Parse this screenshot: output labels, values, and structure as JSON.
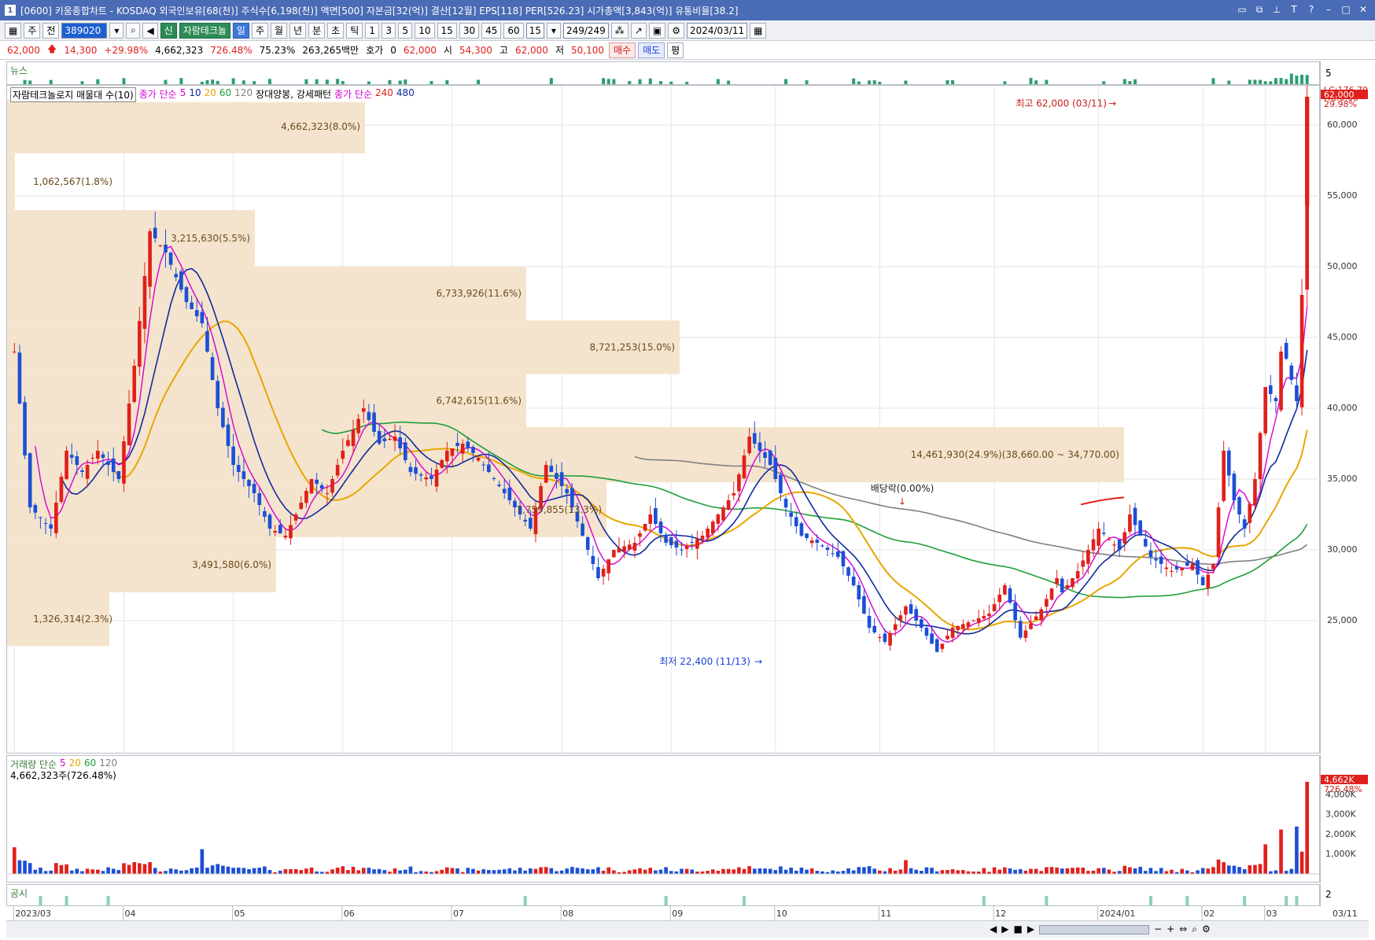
{
  "window": {
    "title": "[0600] 키움종합차트 - KOSDAQ 외국인보유[68(천)] 주식수[6,198(천)] 액면[500] 자본금[32(억)] 결산[12월] EPS[118] PER[526.23] 시가총액[3,843(억)] 유통비율[38.2]",
    "window_number": "1"
  },
  "toolbar1": {
    "market": "주",
    "all": "전",
    "code": "389020",
    "name_prefix": "신",
    "stock_name": "자람테크놀",
    "periods": [
      "일",
      "주",
      "월",
      "년",
      "분",
      "초",
      "틱"
    ],
    "active_period": "일",
    "intervals": [
      "1",
      "3",
      "5",
      "10",
      "15",
      "30",
      "45",
      "60"
    ],
    "count": "15",
    "range": "249/249",
    "date": "2024/03/11"
  },
  "toolbar2": {
    "price": "62,000",
    "change": "14,300",
    "change_pct": "+29.98%",
    "volume": "4,662,323",
    "volume_pct": "726.48%",
    "turnover": "75.23%",
    "amount": "263,265백만",
    "hoga_label": "호가",
    "hoga_value": "0",
    "hoga_price": "62,000",
    "open_label": "시",
    "open": "54,300",
    "high_label": "고",
    "high": "62,000",
    "low_label": "저",
    "low": "50,100",
    "buy": "매수",
    "sell": "매도",
    "eval": "평"
  },
  "news_panel": {
    "title": "뉴스",
    "axis": "5"
  },
  "price_panel": {
    "legend_profile": "자람테크놀로지 매물대 수(10)",
    "legend_ma_label": "종가 단순",
    "legend_ma_periods": [
      "5",
      "10",
      "20",
      "60",
      "120"
    ],
    "legend_candle": "장대양봉, 강세패턴",
    "legend_ma2_label": "종가 단순",
    "legend_ma2_periods": [
      "240",
      "480"
    ],
    "lc_label": "LC:176.79",
    "hc_label": "HC:0.00",
    "current_price": "62,000",
    "current_pct": "29.98%",
    "high_note": "최고 62,000 (03/11)",
    "low_note": "최저 22,400 (11/13)",
    "dividend_note": "배당락(0.00%)",
    "y_ticks": [
      "60,000",
      "55,000",
      "50,000",
      "45,000",
      "40,000",
      "35,000",
      "30,000",
      "25,000"
    ]
  },
  "profile_labels": [
    "4,662,323(8.0%)",
    "1,062,567(1.8%)",
    "3,215,630(5.5%)",
    "6,733,926(11.6%)",
    "8,721,253(15.0%)",
    "6,742,615(11.6%)",
    "14,461,930(24.9%)(38,660.00 ~ 34,770.00)",
    "7,759,855(13.3%)",
    "3,491,580(6.0%)",
    "1,326,314(2.3%)"
  ],
  "volume_panel": {
    "legend": "거래량 단순",
    "legend_periods": [
      "5",
      "20",
      "60",
      "120"
    ],
    "current_volume": "4,662,323주(726.48%)",
    "axis_current": "4,662K",
    "axis_current_pct": "726.48%",
    "y_ticks": [
      "4,000K",
      "3,000K",
      "2,000K",
      "1,000K"
    ]
  },
  "notice_panel": {
    "title": "공시",
    "axis": "2"
  },
  "x_axis": {
    "labels": [
      "2023/03",
      "04",
      "05",
      "06",
      "07",
      "08",
      "09",
      "10",
      "11",
      "12",
      "2024/01",
      "02",
      "03"
    ],
    "right_label": "03/11"
  },
  "colors": {
    "up": "#e0201b",
    "down": "#1c4fd6",
    "ma5": "#d400d4",
    "ma10": "#102a9c",
    "ma20": "#e8a600",
    "ma60": "#1f9e3a",
    "ma120": "#808080",
    "profile": "#f4e4cd"
  }
}
